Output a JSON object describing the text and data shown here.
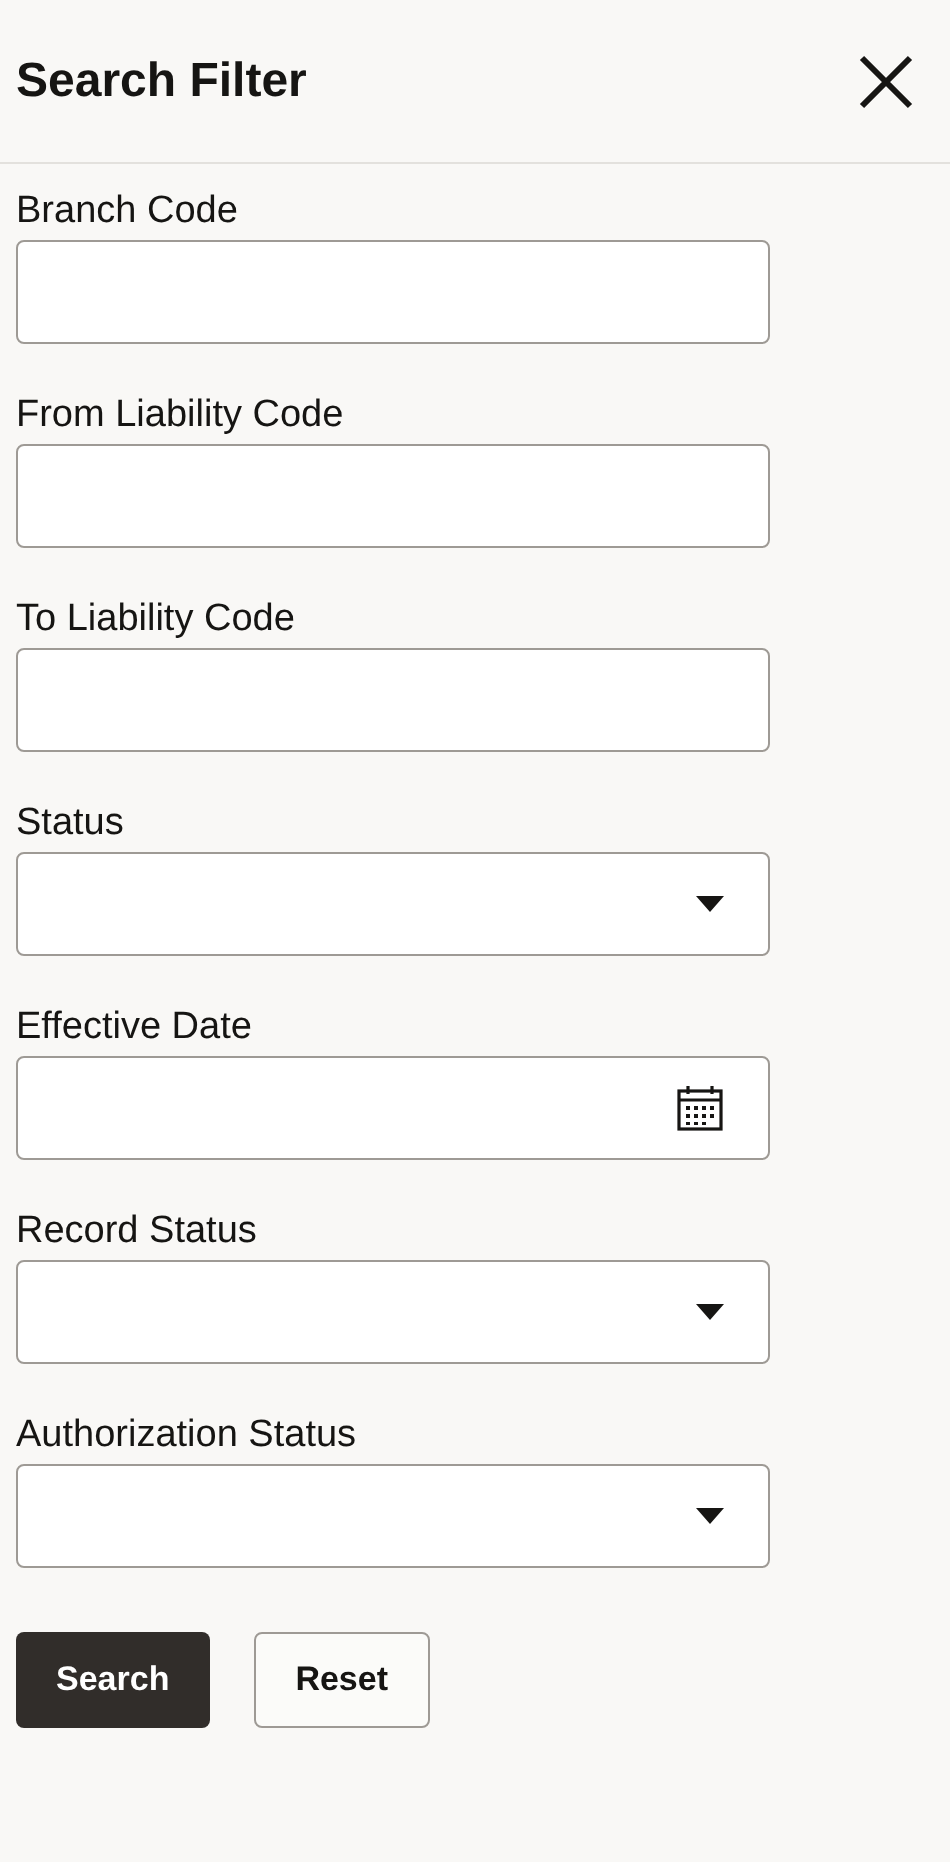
{
  "header": {
    "title": "Search Filter"
  },
  "fields": [
    {
      "label": "Branch Code",
      "kind": "text"
    },
    {
      "label": "From Liability Code",
      "kind": "text"
    },
    {
      "label": "To Liability Code",
      "kind": "text"
    },
    {
      "label": "Status",
      "kind": "select"
    },
    {
      "label": "Effective Date",
      "kind": "date"
    },
    {
      "label": "Record Status",
      "kind": "select"
    },
    {
      "label": "Authorization Status",
      "kind": "select"
    }
  ],
  "buttons": [
    {
      "label": "Search",
      "kind": "primary"
    },
    {
      "label": "Reset",
      "kind": "secondary"
    }
  ]
}
